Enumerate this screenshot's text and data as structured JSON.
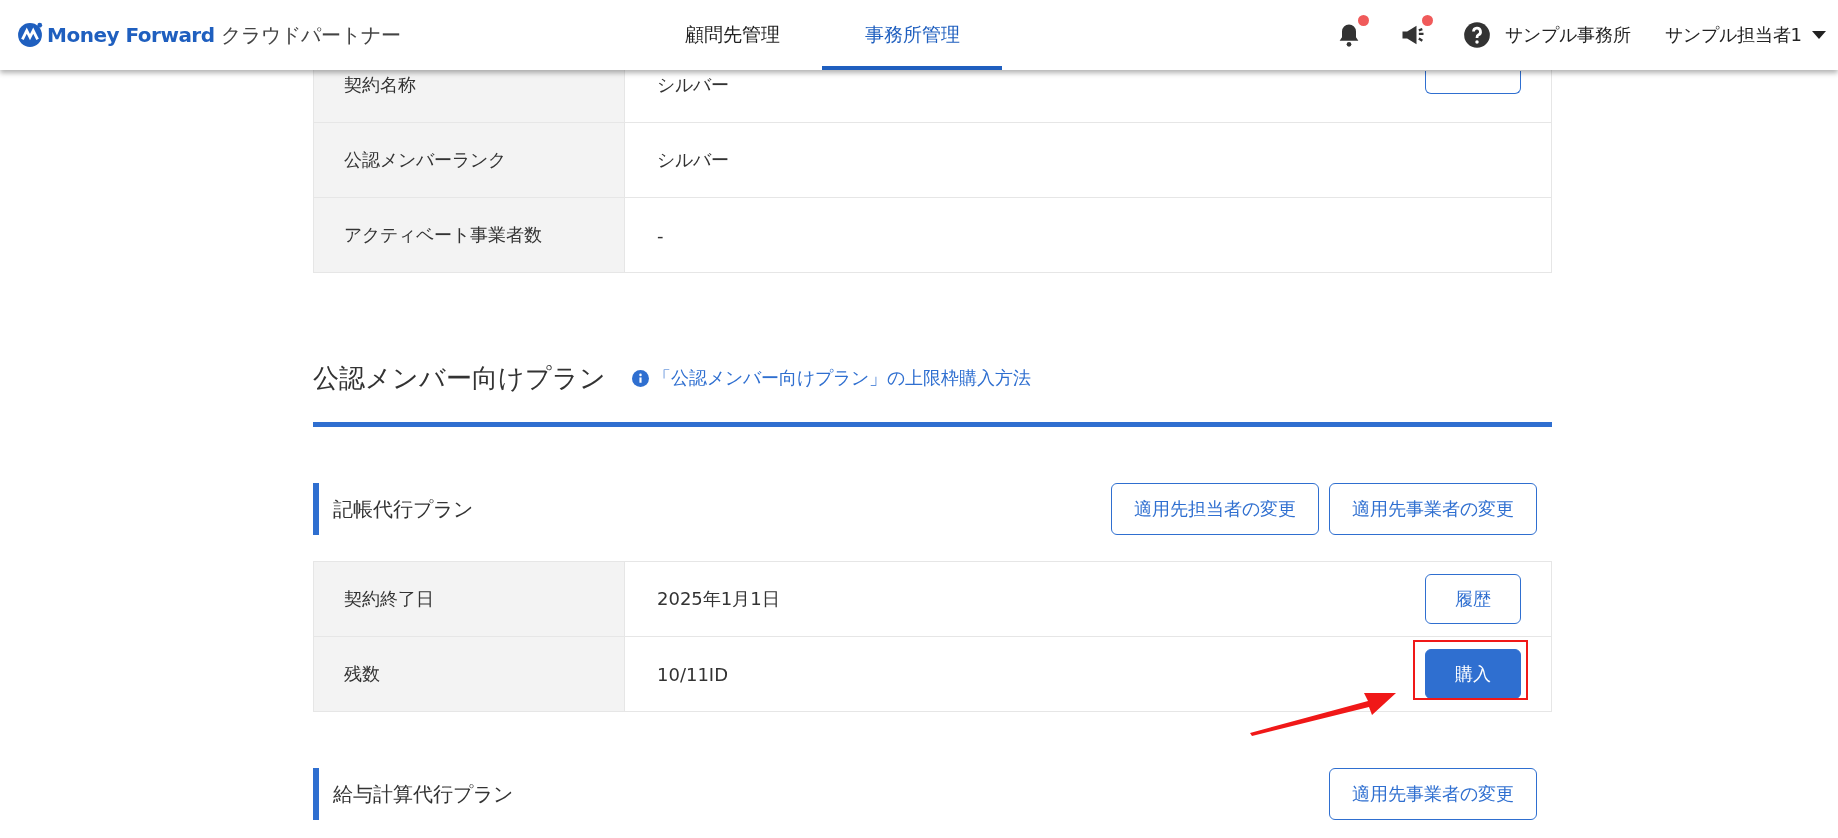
{
  "header": {
    "logo_text": "Money Forward",
    "product": "クラウドパートナー",
    "nav": [
      {
        "label": "顧問先管理",
        "selected": false
      },
      {
        "label": "事務所管理",
        "selected": true
      }
    ],
    "notifications": {
      "unread": true
    },
    "announcements": {
      "unread": true
    },
    "office": "サンプル事務所",
    "user": "サンプル担当者1"
  },
  "contract_table": [
    {
      "label": "契約名称",
      "value": "シルバー",
      "button": {
        "kind": "outline"
      }
    },
    {
      "label": "公認メンバーランク",
      "value": "シルバー"
    },
    {
      "label": "アクティベート事業者数",
      "value": "-"
    }
  ],
  "section": {
    "title": "公認メンバー向けプラン",
    "help_link": "「公認メンバー向けプラン」の上限枠購入方法"
  },
  "plans": [
    {
      "title": "記帳代行プラン",
      "actions": [
        "適用先担当者の変更",
        "適用先事業者の変更"
      ],
      "rows": [
        {
          "label": "契約終了日",
          "value": "2025年1月1日",
          "button": {
            "kind": "outline",
            "label": "履歴"
          }
        },
        {
          "label": "残数",
          "value": "10/11ID",
          "button": {
            "kind": "primary",
            "label": "購入"
          }
        }
      ]
    },
    {
      "title": "給与計算代行プラン",
      "actions": [
        "適用先事業者の変更"
      ]
    }
  ],
  "annotations": {
    "highlight_box": true,
    "arrow": true
  }
}
